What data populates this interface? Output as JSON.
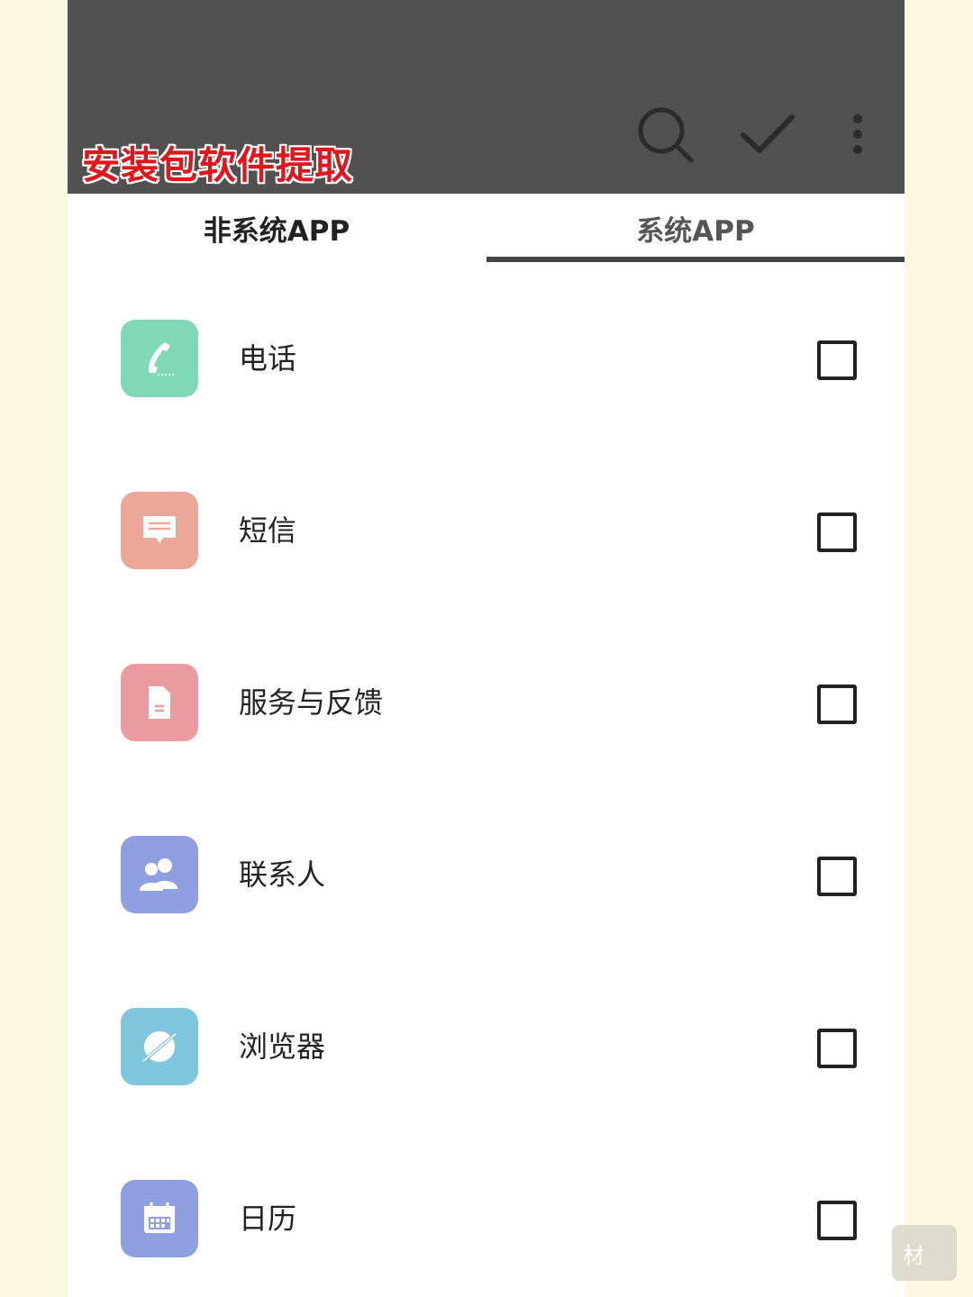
{
  "toolbar": {
    "title": "安装包软件提取",
    "title_color": "#e0161c",
    "background": "#515151",
    "actions": [
      {
        "icon": "search-icon"
      },
      {
        "icon": "check-icon"
      },
      {
        "icon": "more-vert-icon"
      }
    ]
  },
  "tabs": [
    {
      "label": "非系统APP",
      "selected": false
    },
    {
      "label": "系统APP",
      "selected": true
    }
  ],
  "apps": [
    {
      "name": "电话",
      "icon": "phone-icon",
      "color": "#7fd8b6",
      "checked": false
    },
    {
      "name": "短信",
      "icon": "message-icon",
      "color": "#eba898",
      "checked": false
    },
    {
      "name": "服务与反馈",
      "icon": "document-icon",
      "color": "#eb9ba0",
      "checked": false
    },
    {
      "name": "联系人",
      "icon": "contacts-icon",
      "color": "#8f9fe0",
      "checked": false
    },
    {
      "name": "浏览器",
      "icon": "browser-icon",
      "color": "#7fc6dc",
      "checked": false
    },
    {
      "name": "日历",
      "icon": "calendar-icon",
      "color": "#8fa0e0",
      "checked": false
    }
  ],
  "watermark": {
    "text": "材"
  }
}
